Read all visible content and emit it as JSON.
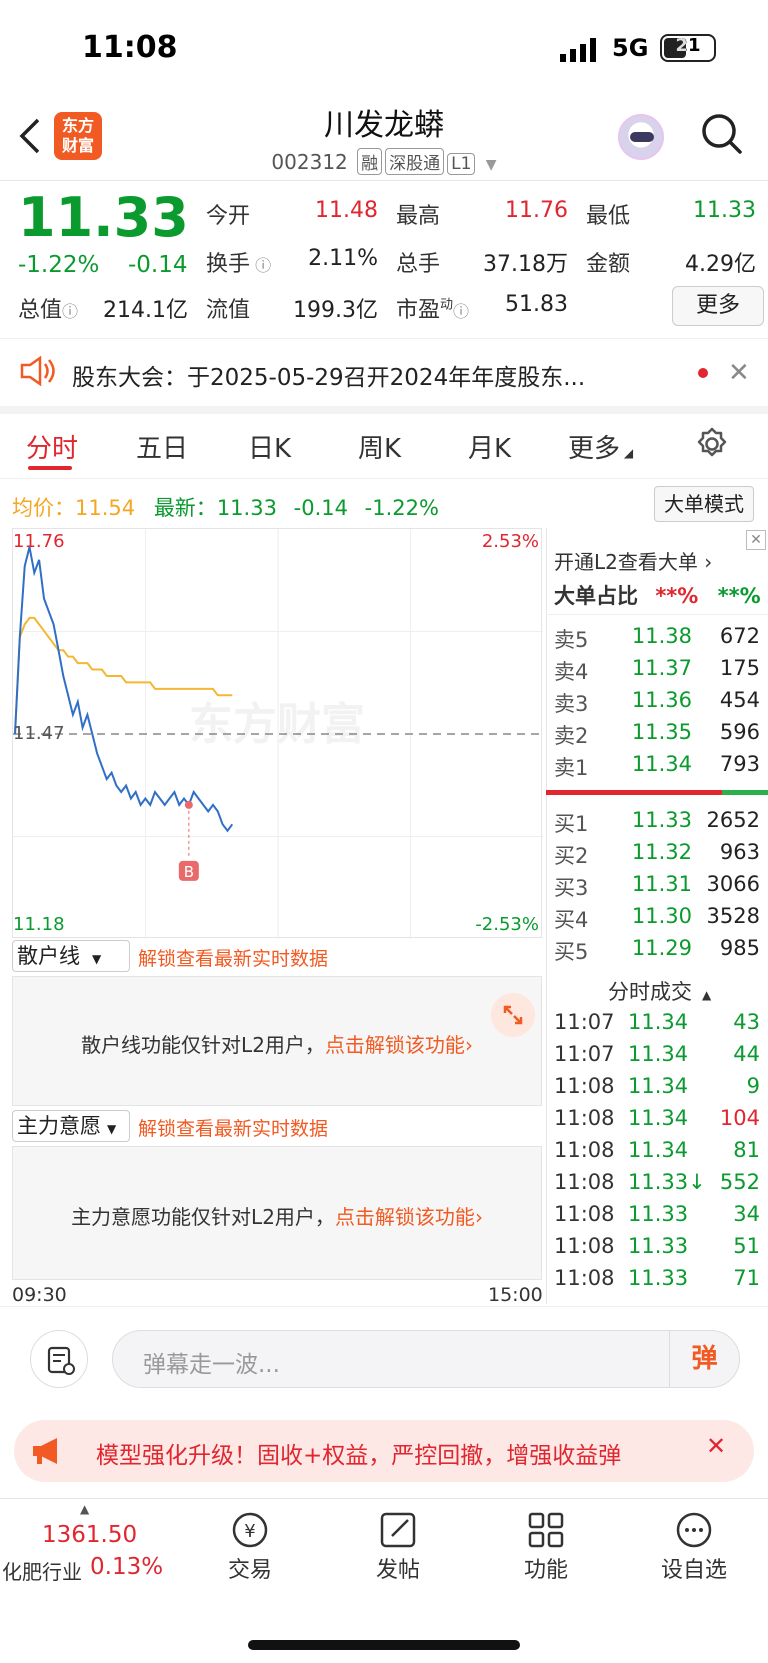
{
  "status": {
    "time": "11:08",
    "network": "5G",
    "battery": "21"
  },
  "header": {
    "logo_text_line1": "东方",
    "logo_text_line2": "财富",
    "title": "川发龙蟒",
    "code": "002312",
    "tags": [
      "融",
      "深股通",
      "L1"
    ]
  },
  "quote": {
    "price": "11.33",
    "change_pct": "-1.22%",
    "change": "-0.14",
    "fields": {
      "open_label": "今开",
      "open": "11.48",
      "high_label": "最高",
      "high": "11.76",
      "low_label": "最低",
      "low": "11.33",
      "turnover_label": "换手",
      "turnover": "2.11%",
      "volume_label": "总手",
      "volume": "37.18万",
      "amount_label": "金额",
      "amount": "4.29亿",
      "mktcap_label": "总值",
      "mktcap": "214.1亿",
      "float_label": "流值",
      "float": "199.3亿",
      "pe_label": "市盈",
      "pe_sup": "动",
      "pe": "51.83"
    },
    "more_label": "更多"
  },
  "notice": {
    "text": "股东大会：于2025-05-29召开2024年年度股东..."
  },
  "tabs": [
    "分时",
    "五日",
    "日K",
    "周K",
    "月K",
    "更多"
  ],
  "chart_info": {
    "avg_label": "均价：",
    "avg": "11.54",
    "latest_label": "最新：",
    "latest": "11.33",
    "latest_chg": "-0.14",
    "latest_pct": "-1.22%",
    "mode_button": "大单模式",
    "watermark": "东方财富"
  },
  "chart_data": {
    "type": "line",
    "y_max_label": "11.76",
    "y_min_label": "11.18",
    "pct_max_label": "2.53%",
    "pct_min_label": "-2.53%",
    "prev_close_label": "11.47",
    "ylim": [
      11.18,
      11.76
    ],
    "prev_close": 11.47,
    "x_start": "09:30",
    "x_end": "15:00",
    "price_series": [
      11.47,
      11.62,
      11.73,
      11.76,
      11.72,
      11.74,
      11.68,
      11.66,
      11.64,
      11.6,
      11.56,
      11.53,
      11.5,
      11.52,
      11.48,
      11.5,
      11.47,
      11.44,
      11.42,
      11.4,
      11.41,
      11.39,
      11.38,
      11.39,
      11.37,
      11.38,
      11.36,
      11.37,
      11.36,
      11.38,
      11.37,
      11.36,
      11.37,
      11.38,
      11.36,
      11.37,
      11.36,
      11.38,
      11.37,
      11.36,
      11.35,
      11.36,
      11.35,
      11.33,
      11.32,
      11.33
    ],
    "avg_series": [
      11.47,
      11.62,
      11.64,
      11.65,
      11.65,
      11.64,
      11.63,
      11.62,
      11.61,
      11.6,
      11.6,
      11.59,
      11.59,
      11.58,
      11.58,
      11.58,
      11.57,
      11.57,
      11.57,
      11.56,
      11.56,
      11.56,
      11.56,
      11.55,
      11.55,
      11.55,
      11.55,
      11.55,
      11.55,
      11.54,
      11.54,
      11.54,
      11.54,
      11.54,
      11.54,
      11.54,
      11.54,
      11.54,
      11.54,
      11.54,
      11.54,
      11.54,
      11.53,
      11.53,
      11.53,
      11.53
    ],
    "buy_marker_index": 36,
    "buy_marker_label": "B",
    "x_fraction_of_session": 0.41
  },
  "panels": [
    {
      "name": "散户线",
      "unlock": "解锁查看最新实时数据",
      "desc": "散户线功能仅针对L2用户，",
      "desc_link": "点击解锁该功能"
    },
    {
      "name": "主力意愿",
      "unlock": "解锁查看最新实时数据",
      "desc": "主力意愿功能仅针对L2用户，",
      "desc_link": "点击解锁该功能"
    }
  ],
  "right_panel": {
    "l2_title": "开通L2查看大单",
    "ratio_label": "大单占比",
    "ratio_red": "**%",
    "ratio_green": "**%",
    "asks": [
      {
        "label": "卖5",
        "price": "11.38",
        "vol": "672"
      },
      {
        "label": "卖4",
        "price": "11.37",
        "vol": "175"
      },
      {
        "label": "卖3",
        "price": "11.36",
        "vol": "454"
      },
      {
        "label": "卖2",
        "price": "11.35",
        "vol": "596"
      },
      {
        "label": "卖1",
        "price": "11.34",
        "vol": "793"
      }
    ],
    "bids": [
      {
        "label": "买1",
        "price": "11.33",
        "vol": "2652"
      },
      {
        "label": "买2",
        "price": "11.32",
        "vol": "963"
      },
      {
        "label": "买3",
        "price": "11.31",
        "vol": "3066"
      },
      {
        "label": "买4",
        "price": "11.30",
        "vol": "3528"
      },
      {
        "label": "买5",
        "price": "11.29",
        "vol": "985"
      }
    ],
    "ticks_title": "分时成交",
    "ticks": [
      {
        "time": "11:07",
        "price": "11.34",
        "vol": "43"
      },
      {
        "time": "11:07",
        "price": "11.34",
        "vol": "44"
      },
      {
        "time": "11:08",
        "price": "11.34",
        "vol": "9"
      },
      {
        "time": "11:08",
        "price": "11.34",
        "vol": "104"
      },
      {
        "time": "11:08",
        "price": "11.34",
        "vol": "81"
      },
      {
        "time": "11:08",
        "price": "11.33↓",
        "vol": "552"
      },
      {
        "time": "11:08",
        "price": "11.33",
        "vol": "34"
      },
      {
        "time": "11:08",
        "price": "11.33",
        "vol": "51"
      },
      {
        "time": "11:08",
        "price": "11.33",
        "vol": "71"
      }
    ]
  },
  "chat": {
    "placeholder": "弹幕走一波...",
    "danmu_btn": "弹"
  },
  "banner": {
    "text": "模型强化升级！固收+权益，严控回撤，增强收益弹"
  },
  "bottom_nav": {
    "index_value": "1361.50",
    "index_name": "化肥行业",
    "index_pct": "0.13%",
    "items": [
      "交易",
      "发帖",
      "功能",
      "设自选"
    ]
  },
  "colors": {
    "up": "#e0262f",
    "down": "#0a9a2e",
    "accent": "#f15a22",
    "price_line": "#2f6fc7",
    "avg_line": "#f5b731"
  }
}
